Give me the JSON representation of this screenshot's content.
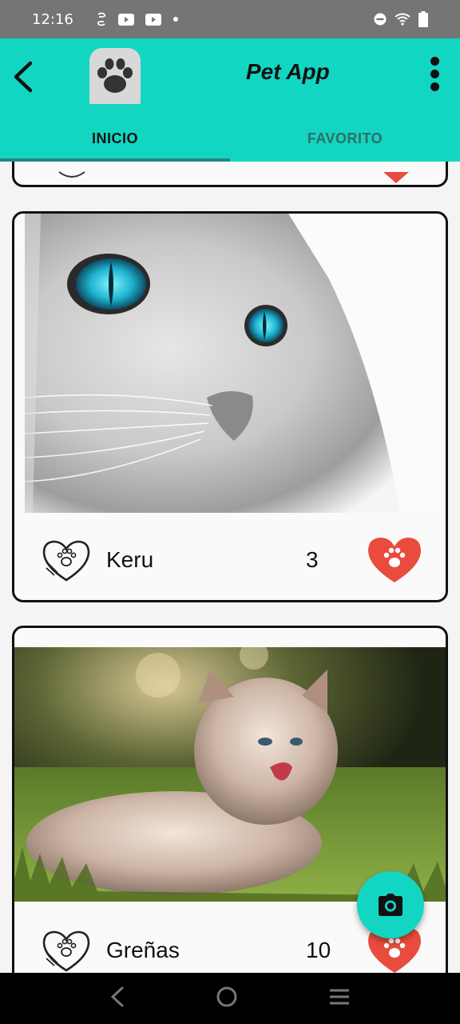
{
  "status_bar": {
    "time": "12:16"
  },
  "app_bar": {
    "title": "Pet App",
    "tabs": [
      {
        "label": "INICIO",
        "active": true
      },
      {
        "label": "FAVORITO",
        "active": false
      }
    ]
  },
  "pets": [
    {
      "name": "Keru",
      "likes": "3"
    },
    {
      "name": "Greñas",
      "likes": "10"
    }
  ],
  "colors": {
    "accent": "#13d6c2",
    "like_red": "#e94b3c",
    "status_bar": "#757575"
  },
  "icons": {
    "back": "arrow-back-icon",
    "menu": "more-vert-icon",
    "fab": "camera-icon",
    "like": "paw-heart-filled-icon",
    "pet": "paw-heart-outline-icon"
  }
}
